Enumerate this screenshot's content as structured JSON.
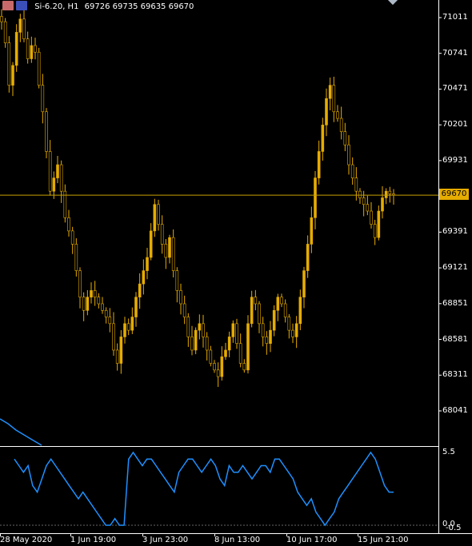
{
  "header": {
    "symbol": "Si-6.20, H1",
    "ohlc": "69726 69735 69635 69670"
  },
  "colors": {
    "background": "#000000",
    "candle": "#e6ac00",
    "price_line": "#c8a000",
    "indicator": "#1e90ff",
    "axis": "#ffffff"
  },
  "price_axis": {
    "labels": [
      "71011",
      "70741",
      "70471",
      "70201",
      "69931",
      "69391",
      "69121",
      "68851",
      "68581",
      "68311",
      "68041"
    ],
    "current_price": "69670"
  },
  "indicator_axis": {
    "top": "5.5",
    "bottom_a": "0.0",
    "bottom_b": "-0.5"
  },
  "time_axis": {
    "labels": [
      "28 May 2020",
      "1 Jun 19:00",
      "3 Jun 23:00",
      "8 Jun 13:00",
      "10 Jun 17:00",
      "15 Jun 21:00"
    ]
  },
  "chart_data": {
    "type": "candlestick",
    "ylim": [
      67900,
      71150
    ],
    "current_price": 69670,
    "close": [
      70980,
      70820,
      70500,
      70650,
      70900,
      71000,
      70850,
      70700,
      70800,
      70750,
      70500,
      70300,
      70000,
      69700,
      69800,
      69900,
      69700,
      69500,
      69400,
      69300,
      69100,
      68900,
      68800,
      68900,
      68950,
      68900,
      68850,
      68800,
      68750,
      68700,
      68500,
      68400,
      68600,
      68700,
      68650,
      68750,
      68900,
      69000,
      69100,
      69200,
      69400,
      69600,
      69450,
      69300,
      69200,
      69350,
      69100,
      68950,
      68850,
      68750,
      68600,
      68500,
      68650,
      68700,
      68600,
      68500,
      68400,
      68350,
      68300,
      68450,
      68500,
      68600,
      68700,
      68550,
      68400,
      68350,
      68700,
      68900,
      68850,
      68700,
      68600,
      68550,
      68650,
      68800,
      68900,
      68850,
      68750,
      68650,
      68600,
      68700,
      68900,
      69100,
      69300,
      69500,
      69800,
      70000,
      70200,
      70400,
      70500,
      70300,
      70250,
      70150,
      70050,
      69900,
      69800,
      69700,
      69650,
      69600,
      69550,
      69450,
      69350,
      69550,
      69650,
      69700,
      69680,
      69670
    ],
    "indicator_ylim": [
      -0.5,
      5.5
    ],
    "indicator": [
      5.0,
      4.5,
      4.0,
      4.5,
      3.0,
      2.5,
      3.5,
      4.5,
      5.0,
      4.5,
      4.0,
      3.5,
      3.0,
      2.5,
      2.0,
      2.5,
      2.0,
      1.5,
      1.0,
      0.5,
      0.0,
      0.0,
      0.5,
      0.0,
      0.0,
      5.0,
      5.5,
      5.0,
      4.5,
      5.0,
      5.0,
      4.5,
      4.0,
      3.5,
      3.0,
      2.5,
      4.0,
      4.5,
      5.0,
      5.0,
      4.5,
      4.0,
      4.5,
      5.0,
      4.5,
      3.5,
      3.0,
      4.5,
      4.0,
      4.0,
      4.5,
      4.0,
      3.5,
      4.0,
      4.5,
      4.5,
      4.0,
      5.0,
      5.0,
      4.5,
      4.0,
      3.5,
      2.5,
      2.0,
      1.5,
      2.0,
      1.0,
      0.5,
      0.0,
      0.5,
      1.0,
      2.0,
      2.5,
      3.0,
      3.5,
      4.0,
      4.5,
      5.0,
      5.5,
      5.0,
      4.0,
      3.0,
      2.5,
      2.5
    ]
  }
}
